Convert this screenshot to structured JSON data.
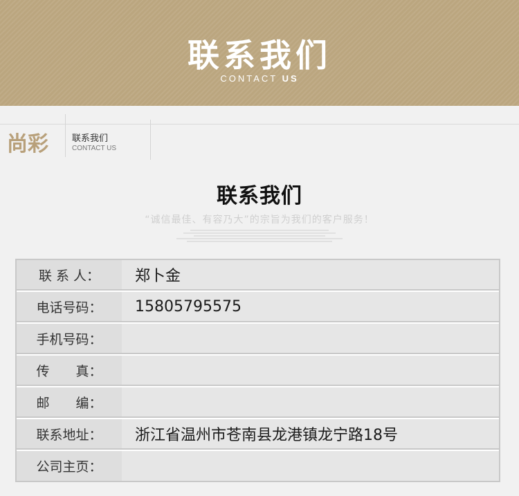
{
  "banner": {
    "title": "联系我们",
    "subtitle_light": "CONTACT ",
    "subtitle_bold": "US"
  },
  "section_header": {
    "brand": "尚彩",
    "title": "联系我们",
    "subtitle": "CONTACT US"
  },
  "main": {
    "title": "联系我们",
    "slogan": "“诚信最佳、有容乃大”的宗旨为我们的客户服务！"
  },
  "contact_table": {
    "rows": [
      {
        "label": "联 系 人：",
        "value": "郑卜金"
      },
      {
        "label": "电话号码：",
        "value": "15805795575"
      },
      {
        "label": "手机号码：",
        "value": ""
      },
      {
        "label": "传　　真：",
        "value": ""
      },
      {
        "label": "邮　　编：",
        "value": ""
      },
      {
        "label": "联系地址：",
        "value": "浙江省温州市苍南县龙港镇龙宁路18号"
      },
      {
        "label": "公司主页：",
        "value": ""
      }
    ]
  },
  "colors": {
    "banner_bg": "#bba67f",
    "brand": "#b8a07a",
    "label_bg": "#dedede",
    "value_bg": "#e6e6e6",
    "border": "#c8c8c8"
  }
}
